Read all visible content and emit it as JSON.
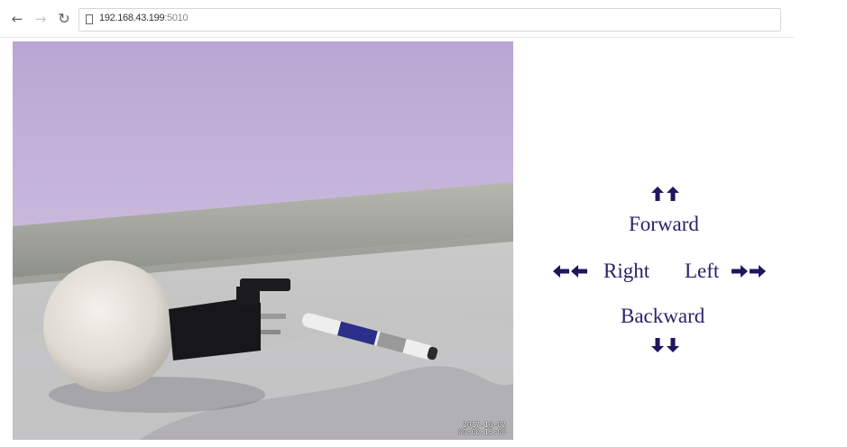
{
  "browser": {
    "url_host": "192.168.43.199",
    "url_port": ":5010",
    "back_icon": "back-arrow-icon",
    "forward_icon": "forward-arrow-icon",
    "reload_icon": "reload-icon"
  },
  "camera": {
    "timestamp_line1": "2017-10-02",
    "timestamp_line2": "00:00:15:00"
  },
  "controls": {
    "forward_label": "Forward",
    "backward_label": "Backward",
    "right_label": "Right",
    "left_label": "Left",
    "accent_color": "#1d1660"
  }
}
